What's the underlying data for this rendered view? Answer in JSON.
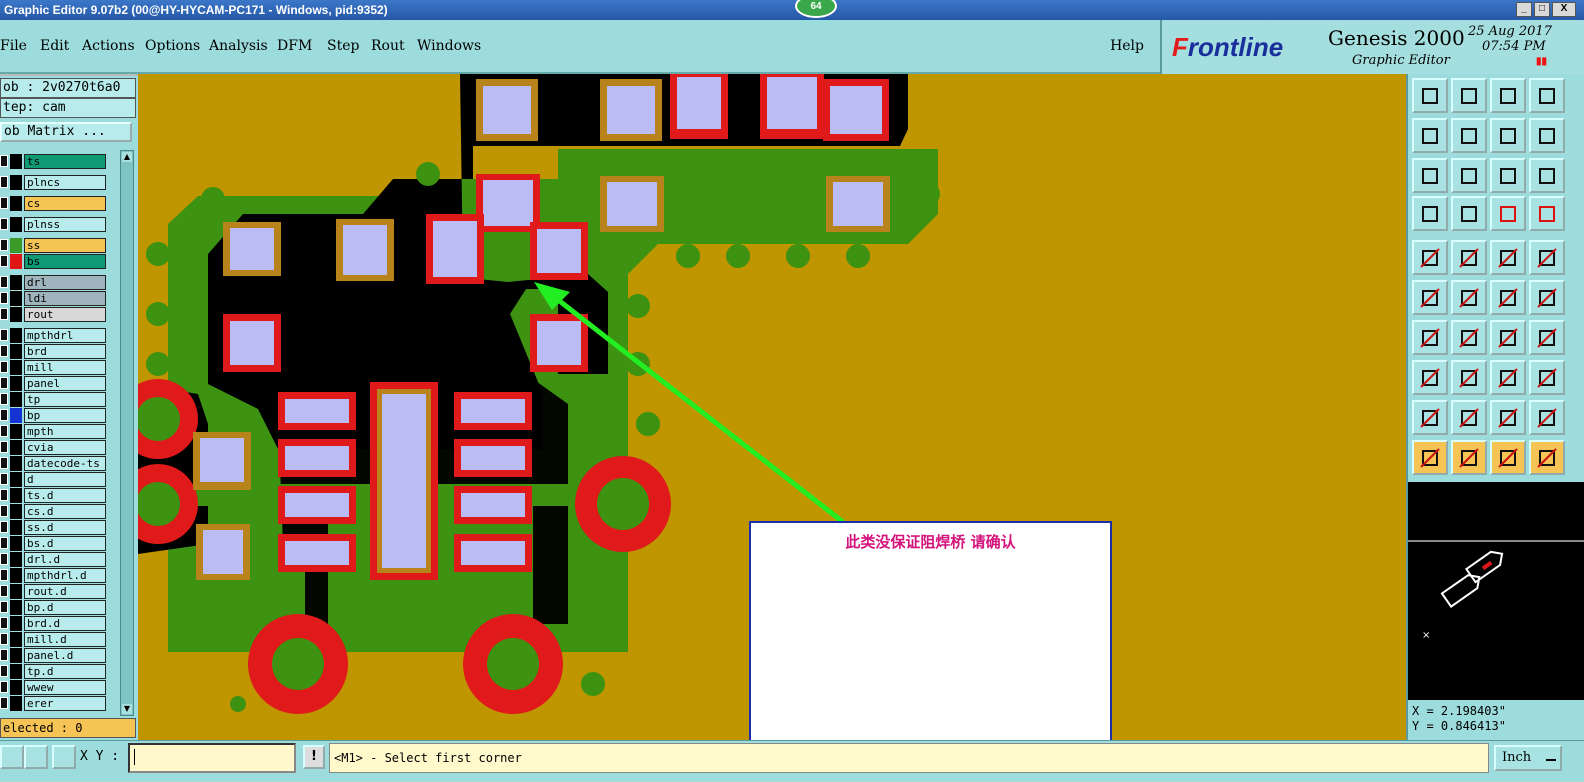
{
  "window": {
    "title": "Graphic Editor 9.07b2 (00@HY-HYCAM-PC171 - Windows, pid:9352)",
    "badge": "64",
    "minimize": "_",
    "maximize": "□",
    "close": "X"
  },
  "menu": {
    "items": [
      "File",
      "Edit",
      "Actions",
      "Options",
      "Analysis",
      "DFM",
      "Step",
      "Rout",
      "Windows"
    ],
    "help": "Help"
  },
  "brand": {
    "logo_prefix": "F",
    "logo_rest": "rontline",
    "product": "Genesis 2000",
    "subtitle": "Graphic Editor",
    "date": "25 Aug 2017",
    "time": "07:54 PM",
    "pause_icon": "pause-icon"
  },
  "left": {
    "job": "ob : 2v0270t6a0",
    "step": "tep: cam",
    "job_matrix": "ob Matrix ...",
    "selected": "elected : 0",
    "layers": [
      {
        "name": "ts",
        "color": "#0e9a74",
        "swatch": "#000"
      },
      {
        "name": "plncs",
        "color": "#b8ecec",
        "swatch": "#000"
      },
      {
        "name": "cs",
        "color": "#f5c454",
        "swatch": "#000"
      },
      {
        "name": "plnss",
        "color": "#b8ecec",
        "swatch": "#000"
      },
      {
        "name": "ss",
        "color": "#f5c454",
        "swatch": "#3a9a2a"
      },
      {
        "name": "bs",
        "color": "#0e9a74",
        "swatch": "#e01515"
      },
      {
        "name": "drl",
        "color": "#9fb4bc",
        "swatch": "#000"
      },
      {
        "name": "ldi",
        "color": "#9fb4bc",
        "swatch": "#000"
      },
      {
        "name": "rout",
        "color": "#d8d8d8",
        "swatch": "#000"
      },
      {
        "name": "mpthdrl",
        "color": "#b8ecec",
        "swatch": "#000"
      },
      {
        "name": "brd",
        "color": "#b8ecec",
        "swatch": "#000"
      },
      {
        "name": "mill",
        "color": "#b8ecec",
        "swatch": "#000"
      },
      {
        "name": "panel",
        "color": "#b8ecec",
        "swatch": "#000"
      },
      {
        "name": "tp",
        "color": "#b8ecec",
        "swatch": "#000"
      },
      {
        "name": "bp",
        "color": "#b8ecec",
        "swatch": "#1633d4"
      },
      {
        "name": "mpth",
        "color": "#b8ecec",
        "swatch": "#000"
      },
      {
        "name": "cvia",
        "color": "#b8ecec",
        "swatch": "#000"
      },
      {
        "name": "datecode-ts",
        "color": "#b8ecec",
        "swatch": "#000"
      },
      {
        "name": "d",
        "color": "#b8ecec",
        "swatch": "#000"
      },
      {
        "name": "ts.d",
        "color": "#b8ecec",
        "swatch": "#000"
      },
      {
        "name": "cs.d",
        "color": "#b8ecec",
        "swatch": "#000"
      },
      {
        "name": "ss.d",
        "color": "#b8ecec",
        "swatch": "#000"
      },
      {
        "name": "bs.d",
        "color": "#b8ecec",
        "swatch": "#000"
      },
      {
        "name": "drl.d",
        "color": "#b8ecec",
        "swatch": "#000"
      },
      {
        "name": "mpthdrl.d",
        "color": "#b8ecec",
        "swatch": "#000"
      },
      {
        "name": "rout.d",
        "color": "#b8ecec",
        "swatch": "#000"
      },
      {
        "name": "bp.d",
        "color": "#b8ecec",
        "swatch": "#000"
      },
      {
        "name": "brd.d",
        "color": "#b8ecec",
        "swatch": "#000"
      },
      {
        "name": "mill.d",
        "color": "#b8ecec",
        "swatch": "#000"
      },
      {
        "name": "panel.d",
        "color": "#b8ecec",
        "swatch": "#000"
      },
      {
        "name": "tp.d",
        "color": "#b8ecec",
        "swatch": "#000"
      },
      {
        "name": "wwew",
        "color": "#b8ecec",
        "swatch": "#000"
      },
      {
        "name": "erer",
        "color": "#b8ecec",
        "swatch": "#000"
      }
    ]
  },
  "canvas": {
    "annotation": "此类没保证阻焊桥    请确认"
  },
  "tools": {
    "icons": [
      "home-up-icon",
      "page-down-icon",
      "home-icon",
      "window-icon",
      "pan-left-icon",
      "pan-right-icon",
      "rotate-icon",
      "mirror-icon",
      "zoom-fit-icon",
      "zoom-center-icon",
      "scale-1to2-icon",
      "help-icon",
      "snap-icon",
      "grid-icon",
      "layer-select-icon",
      "layer-toggle-icon",
      "fill-pad-icon",
      "polygon-icon",
      "ruler-icon",
      "dot-icon",
      "connect-icon",
      "cross-icon",
      "line-to-icon",
      "line-out-icon",
      "angle-icon",
      "diagonal-icon",
      "undo-icon",
      "flip-icon",
      "move-icon",
      "dash-icon",
      "measure-icon",
      "group-icon",
      "triangle-small-icon",
      "triangle-a-icon",
      "triangle-b-icon",
      "triangle-c-icon",
      "pointer-icon",
      "select-box-icon",
      "select-red-icon",
      "select-net-icon"
    ]
  },
  "coords": {
    "x": "X = 2.198403\"",
    "y": "Y = 0.846413\""
  },
  "bottom": {
    "xy_label": "X Y :",
    "warn": "!",
    "status": "<M1> - Select first corner",
    "units": "Inch"
  }
}
